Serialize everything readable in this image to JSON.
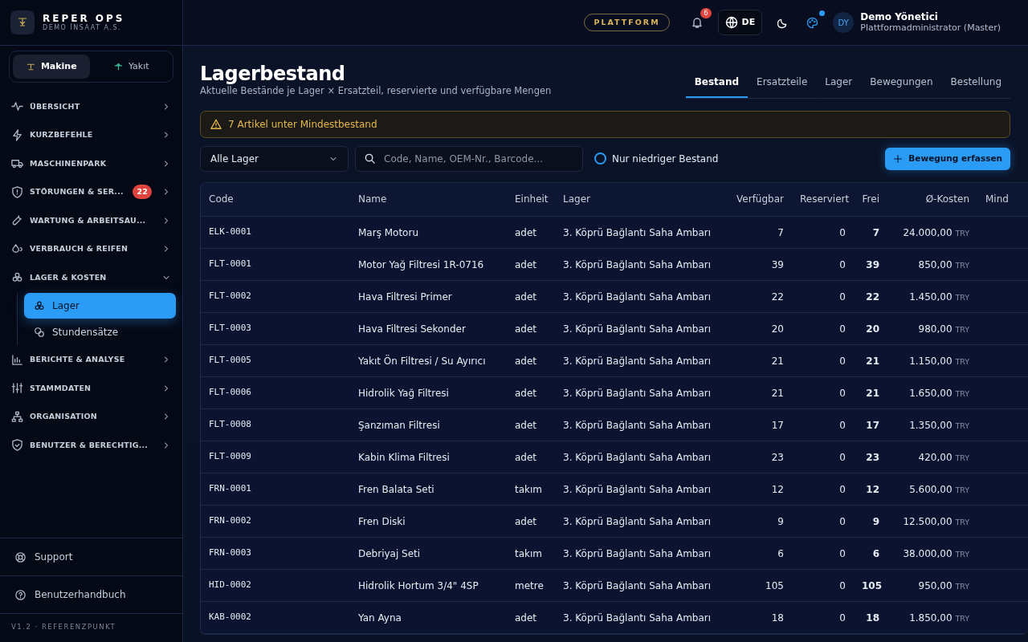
{
  "brand": {
    "title": "REPER OPS",
    "subtitle": "DEMO İNSAAT A.S."
  },
  "modes": [
    {
      "label": "Makine",
      "selected": true
    },
    {
      "label": "Yakıt",
      "selected": false
    }
  ],
  "nav": [
    {
      "label": "ÜBERSICHT",
      "expanded": false
    },
    {
      "label": "KURZBEFEHLE",
      "expanded": false
    },
    {
      "label": "MASCHINENPARK",
      "expanded": false
    },
    {
      "label": "STÖRUNGEN & SER...",
      "badge": "22",
      "expanded": false
    },
    {
      "label": "WARTUNG & ARBEITSAU...",
      "expanded": false
    },
    {
      "label": "VERBRAUCH & REIFEN",
      "expanded": false
    },
    {
      "label": "LAGER & KOSTEN",
      "expanded": true,
      "children": [
        {
          "label": "Lager",
          "selected": true
        },
        {
          "label": "Stundensätze",
          "selected": false
        }
      ]
    },
    {
      "label": "BERICHTE & ANALYSE",
      "expanded": false
    },
    {
      "label": "STAMMDATEN",
      "expanded": false
    },
    {
      "label": "ORGANISATION",
      "expanded": false
    },
    {
      "label": "BENUTZER & BERECHTIG...",
      "expanded": false
    }
  ],
  "footer_links": [
    "Support",
    "Benutzerhandbuch"
  ],
  "version": "V1.2 · REFERENZPUNKT",
  "topbar": {
    "platform": "PLATTFORM",
    "notifications": "6",
    "language": "DE",
    "user_initials": "DY",
    "user_name": "Demo Yönetici",
    "user_role": "Plattformadministrator (Master)"
  },
  "page": {
    "title": "Lagerbestand",
    "subtitle": "Aktuelle Bestände je Lager × Ersatzteil, reservierte und verfügbare Mengen"
  },
  "tabs": [
    {
      "label": "Bestand",
      "selected": true
    },
    {
      "label": "Ersatzteile",
      "selected": false
    },
    {
      "label": "Lager",
      "selected": false
    },
    {
      "label": "Bewegungen",
      "selected": false
    },
    {
      "label": "Bestellung",
      "selected": false
    }
  ],
  "alert": "7 Artikel unter Mindestbestand",
  "filters": {
    "warehouse": "Alle Lager",
    "search_placeholder": "Code, Name, OEM-Nr., Barcode...",
    "low_stock_label": "Nur niedriger Bestand",
    "low_stock_checked": false,
    "add_button": "Bewegung erfassen"
  },
  "table": {
    "columns": [
      "Code",
      "Name",
      "Einheit",
      "Lager",
      "Verfügbar",
      "Reserviert",
      "Frei",
      "Ø-Kosten",
      "Mind"
    ],
    "rows": [
      {
        "code": "ELK-0001",
        "name": "Marş Motoru",
        "unit": "adet",
        "warehouse": "3. Köprü Bağlantı Saha Ambarı",
        "available": "7",
        "reserved": "0",
        "free": "7",
        "cost": "24.000,00",
        "currency": "TRY"
      },
      {
        "code": "FLT-0001",
        "name": "Motor Yağ Filtresi 1R-0716",
        "unit": "adet",
        "warehouse": "3. Köprü Bağlantı Saha Ambarı",
        "available": "39",
        "reserved": "0",
        "free": "39",
        "cost": "850,00",
        "currency": "TRY"
      },
      {
        "code": "FLT-0002",
        "name": "Hava Filtresi Primer",
        "unit": "adet",
        "warehouse": "3. Köprü Bağlantı Saha Ambarı",
        "available": "22",
        "reserved": "0",
        "free": "22",
        "cost": "1.450,00",
        "currency": "TRY"
      },
      {
        "code": "FLT-0003",
        "name": "Hava Filtresi Sekonder",
        "unit": "adet",
        "warehouse": "3. Köprü Bağlantı Saha Ambarı",
        "available": "20",
        "reserved": "0",
        "free": "20",
        "cost": "980,00",
        "currency": "TRY"
      },
      {
        "code": "FLT-0005",
        "name": "Yakıt Ön Filtresi / Su Ayırıcı",
        "unit": "adet",
        "warehouse": "3. Köprü Bağlantı Saha Ambarı",
        "available": "21",
        "reserved": "0",
        "free": "21",
        "cost": "1.150,00",
        "currency": "TRY"
      },
      {
        "code": "FLT-0006",
        "name": "Hidrolik Yağ Filtresi",
        "unit": "adet",
        "warehouse": "3. Köprü Bağlantı Saha Ambarı",
        "available": "21",
        "reserved": "0",
        "free": "21",
        "cost": "1.650,00",
        "currency": "TRY"
      },
      {
        "code": "FLT-0008",
        "name": "Şanzıman Filtresi",
        "unit": "adet",
        "warehouse": "3. Köprü Bağlantı Saha Ambarı",
        "available": "17",
        "reserved": "0",
        "free": "17",
        "cost": "1.350,00",
        "currency": "TRY"
      },
      {
        "code": "FLT-0009",
        "name": "Kabin Klima Filtresi",
        "unit": "adet",
        "warehouse": "3. Köprü Bağlantı Saha Ambarı",
        "available": "23",
        "reserved": "0",
        "free": "23",
        "cost": "420,00",
        "currency": "TRY"
      },
      {
        "code": "FRN-0001",
        "name": "Fren Balata Seti",
        "unit": "takım",
        "warehouse": "3. Köprü Bağlantı Saha Ambarı",
        "available": "12",
        "reserved": "0",
        "free": "12",
        "cost": "5.600,00",
        "currency": "TRY"
      },
      {
        "code": "FRN-0002",
        "name": "Fren Diski",
        "unit": "adet",
        "warehouse": "3. Köprü Bağlantı Saha Ambarı",
        "available": "9",
        "reserved": "0",
        "free": "9",
        "cost": "12.500,00",
        "currency": "TRY"
      },
      {
        "code": "FRN-0003",
        "name": "Debriyaj Seti",
        "unit": "takım",
        "warehouse": "3. Köprü Bağlantı Saha Ambarı",
        "available": "6",
        "reserved": "0",
        "free": "6",
        "cost": "38.000,00",
        "currency": "TRY"
      },
      {
        "code": "HID-0002",
        "name": "Hidrolik Hortum 3/4\" 4SP",
        "unit": "metre",
        "warehouse": "3. Köprü Bağlantı Saha Ambarı",
        "available": "105",
        "reserved": "0",
        "free": "105",
        "cost": "950,00",
        "currency": "TRY"
      },
      {
        "code": "KAB-0002",
        "name": "Yan Ayna",
        "unit": "adet",
        "warehouse": "3. Köprü Bağlantı Saha Ambarı",
        "available": "18",
        "reserved": "0",
        "free": "18",
        "cost": "1.850,00",
        "currency": "TRY"
      }
    ]
  }
}
